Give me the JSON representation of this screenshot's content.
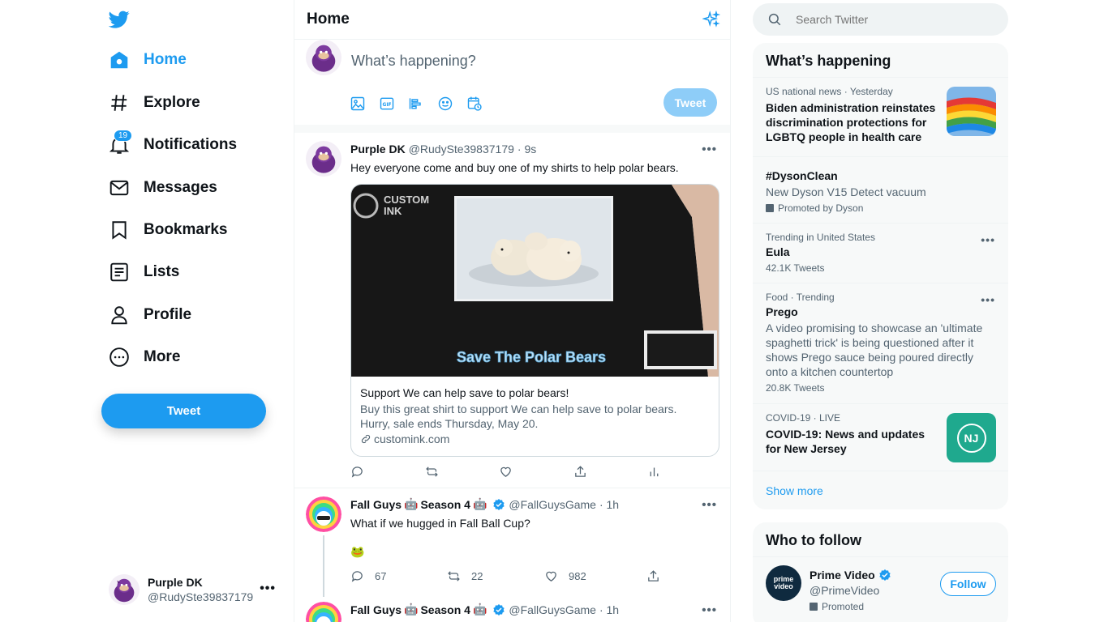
{
  "nav": {
    "items": [
      {
        "label": "Home",
        "icon": "home-icon"
      },
      {
        "label": "Explore",
        "icon": "hashtag-icon"
      },
      {
        "label": "Notifications",
        "icon": "bell-icon",
        "badge": "19"
      },
      {
        "label": "Messages",
        "icon": "envelope-icon"
      },
      {
        "label": "Bookmarks",
        "icon": "bookmark-icon"
      },
      {
        "label": "Lists",
        "icon": "list-icon"
      },
      {
        "label": "Profile",
        "icon": "person-icon"
      },
      {
        "label": "More",
        "icon": "more-circle-icon"
      }
    ],
    "tweet_button": "Tweet"
  },
  "account": {
    "name": "Purple DK",
    "handle": "@RudySte39837179"
  },
  "timeline": {
    "title": "Home",
    "composer": {
      "placeholder": "What’s happening?",
      "tweet_label": "Tweet"
    },
    "tweets": [
      {
        "name": "Purple DK",
        "handle": "@RudySte39837179",
        "time": "· 9s",
        "text": "Hey everyone come and buy one of my shirts to help polar bears.",
        "card": {
          "image_brand": "CUSTOM INK",
          "image_caption": "Save The Polar Bears",
          "title": "Support We can help save to polar bears!",
          "description": "Buy this great shirt to support We can help save to polar bears. Hurry, sale ends Thursday, May 20.",
          "link": "customink.com"
        }
      },
      {
        "name": "Fall Guys",
        "emoji": "🤖",
        "season": "Season 4",
        "handle": "@FallGuysGame",
        "time": "· 1h",
        "text": "What if we hugged in Fall Ball Cup?",
        "emoji_line": "🐸",
        "replies": "67",
        "retweets": "22",
        "likes": "982"
      },
      {
        "name": "Fall Guys",
        "emoji": "🤖",
        "season": "Season 4",
        "handle": "@FallGuysGame",
        "time": "· 1h"
      }
    ]
  },
  "right": {
    "search_placeholder": "Search Twitter",
    "whats_happening": {
      "title": "What’s happening",
      "trends": [
        {
          "meta": "US national news · Yesterday",
          "headline": "Biden administration reinstates discrimination protections for LGBTQ people in health care"
        },
        {
          "headline": "#DysonClean",
          "sub": "New Dyson V15 Detect vacuum",
          "promoted": "Promoted by Dyson"
        },
        {
          "meta": "Trending in United States",
          "headline": "Eula",
          "count": "42.1K Tweets"
        },
        {
          "meta": "Food · Trending",
          "headline": "Prego",
          "sub": "A video promising to showcase an 'ultimate spaghetti trick' is being questioned after it shows Prego sauce being poured directly onto a kitchen countertop",
          "count": "20.8K Tweets"
        },
        {
          "meta": "COVID-19 · LIVE",
          "headline": "COVID-19: News and updates for New Jersey",
          "thumb_text": "NJ"
        }
      ],
      "show_more": "Show more"
    },
    "who_to_follow": {
      "title": "Who to follow",
      "accounts": [
        {
          "name": "Prime Video",
          "handle": "@PrimeVideo",
          "promoted": "Promoted",
          "follow_label": "Follow",
          "avatar_text": "prime video"
        }
      ]
    }
  },
  "colors": {
    "accent": "#1d9bf0",
    "text": "#0f1419",
    "secondary": "#536471"
  }
}
